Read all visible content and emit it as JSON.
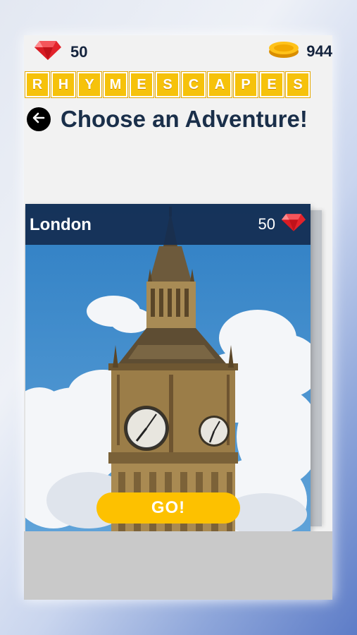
{
  "header": {
    "gems": "50",
    "coins": "944",
    "gem_icon": "ruby-gem-icon",
    "coin_icon": "gold-coin-icon"
  },
  "logo": {
    "letters": [
      "R",
      "H",
      "Y",
      "M",
      "E",
      "S",
      "C",
      "A",
      "P",
      "E",
      "S"
    ]
  },
  "title": {
    "text": "Choose an Adventure!",
    "back_icon": "back-arrow-icon"
  },
  "card": {
    "city": "London",
    "cost": "50",
    "cost_icon": "ruby-gem-icon",
    "image": "big-ben-clock-tower",
    "go_label": "GO!"
  },
  "colors": {
    "logo_tile": "#f6c20b",
    "go_button": "#fdc100",
    "header_bg": "#142d50",
    "title_text": "#1a2f4a"
  }
}
